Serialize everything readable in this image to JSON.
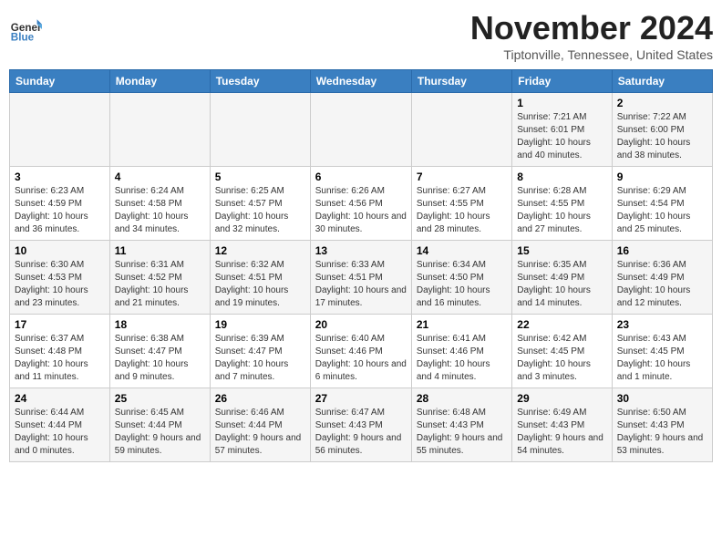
{
  "logo": {
    "general": "General",
    "blue": "Blue"
  },
  "title": "November 2024",
  "location": "Tiptonville, Tennessee, United States",
  "weekdays": [
    "Sunday",
    "Monday",
    "Tuesday",
    "Wednesday",
    "Thursday",
    "Friday",
    "Saturday"
  ],
  "weeks": [
    [
      {
        "day": "",
        "info": ""
      },
      {
        "day": "",
        "info": ""
      },
      {
        "day": "",
        "info": ""
      },
      {
        "day": "",
        "info": ""
      },
      {
        "day": "",
        "info": ""
      },
      {
        "day": "1",
        "info": "Sunrise: 7:21 AM\nSunset: 6:01 PM\nDaylight: 10 hours\nand 40 minutes."
      },
      {
        "day": "2",
        "info": "Sunrise: 7:22 AM\nSunset: 6:00 PM\nDaylight: 10 hours\nand 38 minutes."
      }
    ],
    [
      {
        "day": "3",
        "info": "Sunrise: 6:23 AM\nSunset: 4:59 PM\nDaylight: 10 hours\nand 36 minutes."
      },
      {
        "day": "4",
        "info": "Sunrise: 6:24 AM\nSunset: 4:58 PM\nDaylight: 10 hours\nand 34 minutes."
      },
      {
        "day": "5",
        "info": "Sunrise: 6:25 AM\nSunset: 4:57 PM\nDaylight: 10 hours\nand 32 minutes."
      },
      {
        "day": "6",
        "info": "Sunrise: 6:26 AM\nSunset: 4:56 PM\nDaylight: 10 hours\nand 30 minutes."
      },
      {
        "day": "7",
        "info": "Sunrise: 6:27 AM\nSunset: 4:55 PM\nDaylight: 10 hours\nand 28 minutes."
      },
      {
        "day": "8",
        "info": "Sunrise: 6:28 AM\nSunset: 4:55 PM\nDaylight: 10 hours\nand 27 minutes."
      },
      {
        "day": "9",
        "info": "Sunrise: 6:29 AM\nSunset: 4:54 PM\nDaylight: 10 hours\nand 25 minutes."
      }
    ],
    [
      {
        "day": "10",
        "info": "Sunrise: 6:30 AM\nSunset: 4:53 PM\nDaylight: 10 hours\nand 23 minutes."
      },
      {
        "day": "11",
        "info": "Sunrise: 6:31 AM\nSunset: 4:52 PM\nDaylight: 10 hours\nand 21 minutes."
      },
      {
        "day": "12",
        "info": "Sunrise: 6:32 AM\nSunset: 4:51 PM\nDaylight: 10 hours\nand 19 minutes."
      },
      {
        "day": "13",
        "info": "Sunrise: 6:33 AM\nSunset: 4:51 PM\nDaylight: 10 hours\nand 17 minutes."
      },
      {
        "day": "14",
        "info": "Sunrise: 6:34 AM\nSunset: 4:50 PM\nDaylight: 10 hours\nand 16 minutes."
      },
      {
        "day": "15",
        "info": "Sunrise: 6:35 AM\nSunset: 4:49 PM\nDaylight: 10 hours\nand 14 minutes."
      },
      {
        "day": "16",
        "info": "Sunrise: 6:36 AM\nSunset: 4:49 PM\nDaylight: 10 hours\nand 12 minutes."
      }
    ],
    [
      {
        "day": "17",
        "info": "Sunrise: 6:37 AM\nSunset: 4:48 PM\nDaylight: 10 hours\nand 11 minutes."
      },
      {
        "day": "18",
        "info": "Sunrise: 6:38 AM\nSunset: 4:47 PM\nDaylight: 10 hours\nand 9 minutes."
      },
      {
        "day": "19",
        "info": "Sunrise: 6:39 AM\nSunset: 4:47 PM\nDaylight: 10 hours\nand 7 minutes."
      },
      {
        "day": "20",
        "info": "Sunrise: 6:40 AM\nSunset: 4:46 PM\nDaylight: 10 hours\nand 6 minutes."
      },
      {
        "day": "21",
        "info": "Sunrise: 6:41 AM\nSunset: 4:46 PM\nDaylight: 10 hours\nand 4 minutes."
      },
      {
        "day": "22",
        "info": "Sunrise: 6:42 AM\nSunset: 4:45 PM\nDaylight: 10 hours\nand 3 minutes."
      },
      {
        "day": "23",
        "info": "Sunrise: 6:43 AM\nSunset: 4:45 PM\nDaylight: 10 hours\nand 1 minute."
      }
    ],
    [
      {
        "day": "24",
        "info": "Sunrise: 6:44 AM\nSunset: 4:44 PM\nDaylight: 10 hours\nand 0 minutes."
      },
      {
        "day": "25",
        "info": "Sunrise: 6:45 AM\nSunset: 4:44 PM\nDaylight: 9 hours\nand 59 minutes."
      },
      {
        "day": "26",
        "info": "Sunrise: 6:46 AM\nSunset: 4:44 PM\nDaylight: 9 hours\nand 57 minutes."
      },
      {
        "day": "27",
        "info": "Sunrise: 6:47 AM\nSunset: 4:43 PM\nDaylight: 9 hours\nand 56 minutes."
      },
      {
        "day": "28",
        "info": "Sunrise: 6:48 AM\nSunset: 4:43 PM\nDaylight: 9 hours\nand 55 minutes."
      },
      {
        "day": "29",
        "info": "Sunrise: 6:49 AM\nSunset: 4:43 PM\nDaylight: 9 hours\nand 54 minutes."
      },
      {
        "day": "30",
        "info": "Sunrise: 6:50 AM\nSunset: 4:43 PM\nDaylight: 9 hours\nand 53 minutes."
      }
    ]
  ]
}
